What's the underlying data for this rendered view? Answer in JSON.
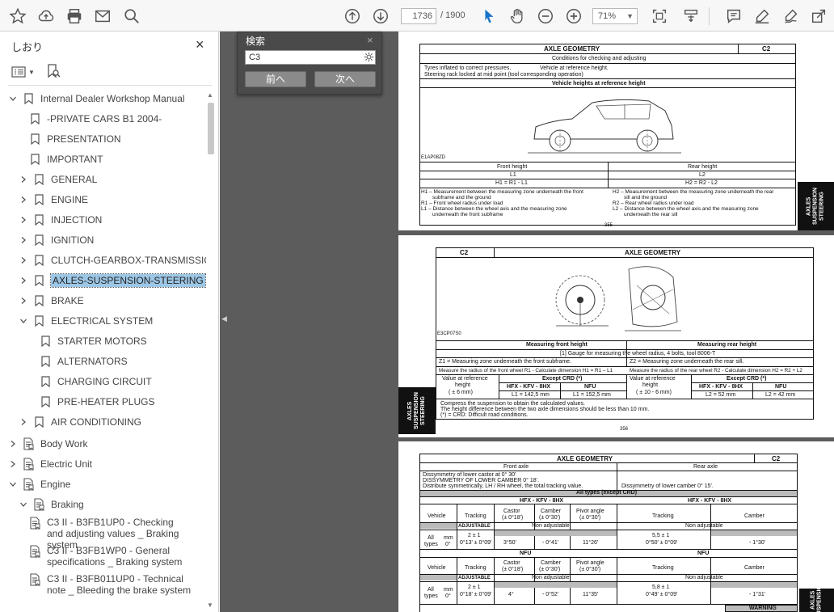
{
  "toolbar": {
    "page_current": "1736",
    "page_total": "/ 1900",
    "zoom": "71%"
  },
  "panel": {
    "title": "しおり",
    "close": "×"
  },
  "tree": [
    {
      "label": "Internal Dealer Workshop Manual"
    },
    {
      "label": "-PRIVATE CARS B1 2004-"
    },
    {
      "label": "PRESENTATION"
    },
    {
      "label": "IMPORTANT"
    },
    {
      "label": "GENERAL"
    },
    {
      "label": "ENGINE"
    },
    {
      "label": "INJECTION"
    },
    {
      "label": "IGNITION"
    },
    {
      "label": "CLUTCH-GEARBOX-TRANSMISSION"
    },
    {
      "label": "AXLES-SUSPENSION-STEERING"
    },
    {
      "label": "BRAKE"
    },
    {
      "label": "ELECTRICAL SYSTEM"
    },
    {
      "label": "STARTER MOTORS"
    },
    {
      "label": "ALTERNATORS"
    },
    {
      "label": "CHARGING CIRCUIT"
    },
    {
      "label": "PRE-HEATER PLUGS"
    },
    {
      "label": "AIR CONDITIONING"
    },
    {
      "label": "Body Work"
    },
    {
      "label": "Electric Unit"
    },
    {
      "label": "Engine"
    },
    {
      "label": "Braking"
    },
    {
      "label": "C3 II - B3FB1UP0 - Checking and adjusting values _ Braking system"
    },
    {
      "label": "C3 II - B3FB1WP0 - General specifications _ Braking system"
    },
    {
      "label": "C3 II - B3FB011UP0 - Technical note _ Bleeding the brake system"
    }
  ],
  "find": {
    "title": "検索",
    "close": "×",
    "query": "C3",
    "prev": "前へ",
    "next": "次へ"
  },
  "doc": {
    "p1": {
      "title": "AXLE GEOMETRY",
      "code": "C2",
      "subtitle": "Conditions for checking and adjusting",
      "cond1": "Tyres inflated to correct pressures.",
      "cond2": "Vehicle at reference height.",
      "cond3": "Steering rack locked at mid point (tool corresponding operation)",
      "ref_heading": "Vehicle heights at reference height",
      "fig": "E1AP08ZD",
      "front_h": "Front height",
      "rear_h": "Rear height",
      "l1": "L1",
      "l2": "L2",
      "f_formula": "H1 = R1 - L1",
      "r_formula": "H2 = R2 - L2",
      "f1": "H1 – Measurement between the measuring zone underneath the front",
      "f1b": "subframe and the ground",
      "f2": "R1 – Front wheel radius under load",
      "f3": "L1 – Distance between the wheel axis and the measuring zone",
      "f3b": "underneath the front subframe",
      "r1": "H2 – Measurement between the measuring zone underneath the rear",
      "r1b": "sill and the ground",
      "r2": "R2 – Rear wheel radius under load",
      "r3": "L2 – Distance between the wheel axis and the measuring zone",
      "r3b": "underneath the rear sill",
      "pageno": "355",
      "tab": "AXLES SUSPENSION STEERING"
    },
    "p2": {
      "code": "C2",
      "title": "AXLE GEOMETRY",
      "fig": "E3CP07S0",
      "mfh": "Measuring front height",
      "mrh": "Measuring rear height",
      "gauge": "[1] Gauge for measuring the wheel radius, 4 bolts, tool 8006-T",
      "z1": "Z1 = Measuring zone underneath the front subframe.",
      "z2": "Z2 = Measuring zone underneath the rear sill.",
      "m1": "Measure the radius of the front wheel R1 - Calculate dimension H1 = R1 – L1",
      "m2": "Measure the radius of the rear wheel R2 - Calculate dimension H2 = R2 + L2",
      "vrh": "Value at reference",
      "vrh2": "height",
      "tol": "( ± 6 mm)",
      "tol2": "( ± 10 - 6 mm)",
      "except": "Except CRD (*)",
      "hfx": "HFX - KFV - 8HX",
      "nfu": "NFU",
      "lf1": "L1 = 142,5 mm",
      "lf2": "L1 = 152,5 mm",
      "lr1": "L2 = 52 mm",
      "lr2": "L2 = 42 mm",
      "n1": "Compress the suspension to obtain the calculated values.",
      "n2": "The height difference between the two axle dimensions should be less than 10 mm.",
      "n3": "(*) = CRD: Difficult road conditions.",
      "pageno": "356",
      "tab": "AXLES SUSPENSION STEERING"
    },
    "p3": {
      "title": "AXLE GEOMETRY",
      "code": "C2",
      "front_axle": "Front axle",
      "rear_axle": "Rear axle",
      "a1": "Dissymmetry of lower castor at 0° 30'",
      "a2": "DISSYMMETRY OF LOWER CAMBER 0° 18'.",
      "a3": "Distribute symmetrically, LH / RH wheel, the total tracking value.",
      "a4": "Dissymmetry of lower camber 0° 15'.",
      "all_types": "All types (except CRD)",
      "hfx": "HFX - KFV - 8HX",
      "nfu": "NFU",
      "vehicle": "Vehicle",
      "tracking": "Tracking",
      "castor": "Castor",
      "castor_t": "(± 0°18')",
      "camber": "Camber",
      "camber_t": "(± 0°30')",
      "pivot": "Pivot angle",
      "pivot_t": "(± 0°30')",
      "adjustable": "ADJUSTABLE",
      "non_adj": "Non adjustable",
      "non_adj2": "Non adjustable",
      "all": "All",
      "types": "types",
      "mm": "mm",
      "deg": "0°",
      "tr1": "2 ± 1",
      "tr1d": "0°13' ± 0°09'",
      "cas1": "3°50'",
      "cam1": "- 0°41'",
      "piv1": "11°26'",
      "rtr1": "5,5 ± 1",
      "rtr1d": "0°50' ± 0°09'",
      "rcam1": "- 1°30'",
      "tr2": "2 ± 1",
      "tr2d": "0°18' ± 0°09'",
      "cas2": "4°",
      "cam2": "- 0°52'",
      "piv2": "11°35'",
      "rtr2": "5,8 ± 1",
      "rtr2d": "0°49' ± 0°09'",
      "rcam2": "- 1°31'",
      "warning": "WARNING",
      "tab": "AXLES SUSPENSION"
    }
  }
}
